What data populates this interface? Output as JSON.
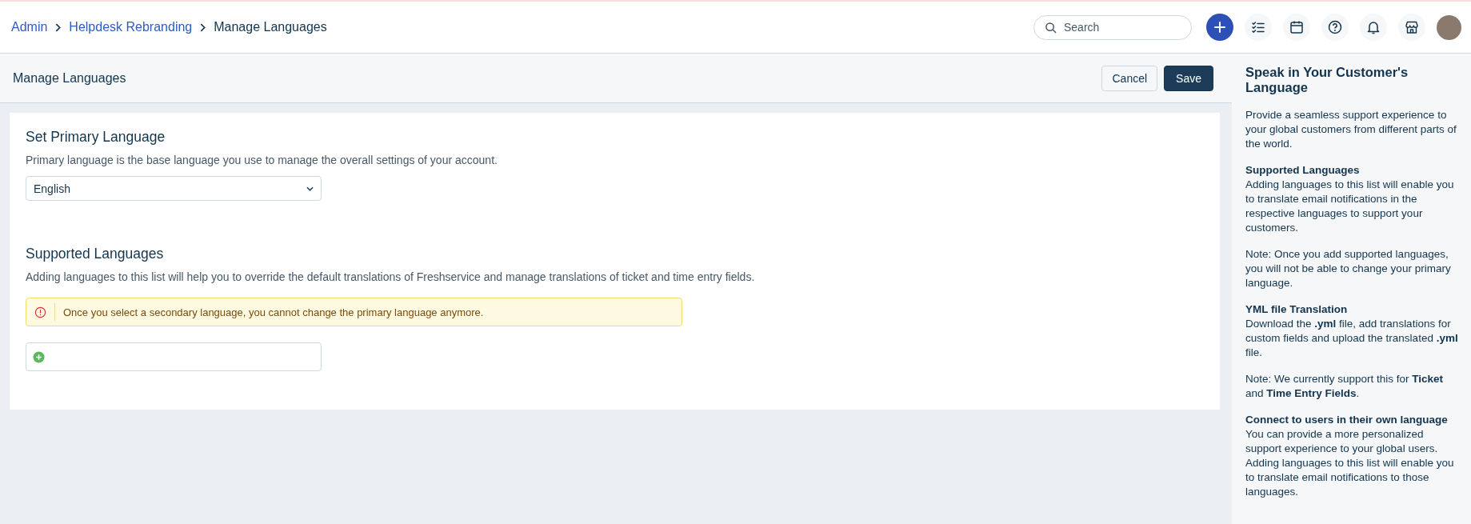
{
  "breadcrumb": [
    {
      "label": "Admin",
      "link": true
    },
    {
      "label": "Helpdesk Rebranding",
      "link": true
    },
    {
      "label": "Manage Languages",
      "link": false
    }
  ],
  "search": {
    "placeholder": "Search"
  },
  "page_header": {
    "title": "Manage Languages",
    "buttons": [
      {
        "label": "Cancel",
        "kind": "secondary"
      },
      {
        "label": "Save",
        "kind": "primary"
      }
    ]
  },
  "primary_language": {
    "title": "Set Primary Language",
    "description": "Primary language is the base language you use to manage the overall settings of your account.",
    "value": "English"
  },
  "supported_languages": {
    "title": "Supported Languages",
    "description": "Adding languages to this list will help you to override the default translations of Freshservice and manage translations of ticket and time entry fields.",
    "alert": "Once you select a secondary language, you cannot change the primary language anymore."
  },
  "side_panel": {
    "title": "Speak in Your Customer's Language",
    "sections": [
      {
        "text": "Provide a seamless support experience to your global customers from different parts of the world."
      },
      {
        "heading": "Supported Languages",
        "text": "Adding languages to this list will enable you to translate email notifications in the respective languages to support your customers."
      },
      {
        "text": "Note: Once you add supported languages, you will not be able to change your primary language."
      },
      {
        "heading": "YML file Translation",
        "text": "Download the **.yml** file, add translations for custom fields and upload the translated **.yml** file."
      },
      {
        "text": "Note: We currently support this for **Ticket** and **Time Entry Fields**."
      },
      {
        "heading": "Connect to users in their own language",
        "text": "You can provide a more personalized support experience to your global users. Adding languages to this list will enable you to translate email notifications to those languages."
      }
    ]
  }
}
